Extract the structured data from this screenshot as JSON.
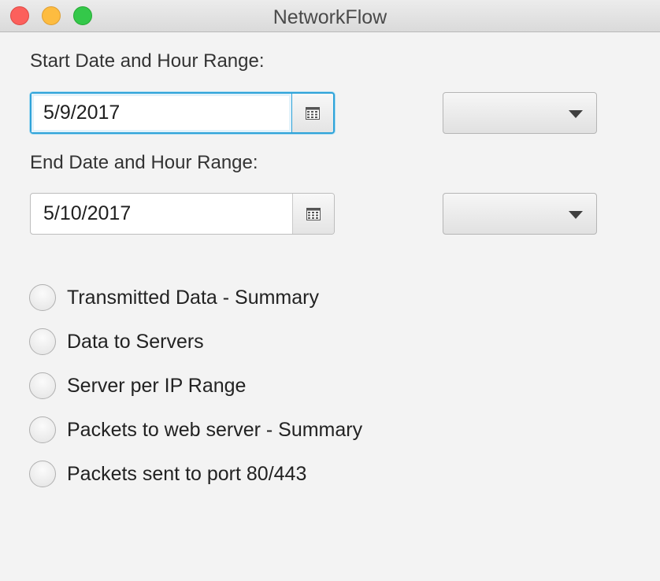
{
  "window": {
    "title": "NetworkFlow"
  },
  "start": {
    "label": "Start Date and Hour Range:",
    "date_value": "5/9/2017",
    "hour_value": ""
  },
  "end": {
    "label": "End Date and Hour Range:",
    "date_value": "5/10/2017",
    "hour_value": ""
  },
  "options": [
    {
      "label": "Transmitted Data - Summary",
      "selected": false
    },
    {
      "label": "Data to Servers",
      "selected": false
    },
    {
      "label": "Server per IP Range",
      "selected": false
    },
    {
      "label": "Packets to web server - Summary",
      "selected": false
    },
    {
      "label": "Packets sent to port 80/443",
      "selected": false
    }
  ],
  "icons": {
    "calendar": "calendar-icon",
    "dropdown": "chevron-down-icon"
  },
  "colors": {
    "focus": "#2fa3d9",
    "close": "#fc605c",
    "minimize": "#fdbc40",
    "zoom": "#34c84a"
  }
}
